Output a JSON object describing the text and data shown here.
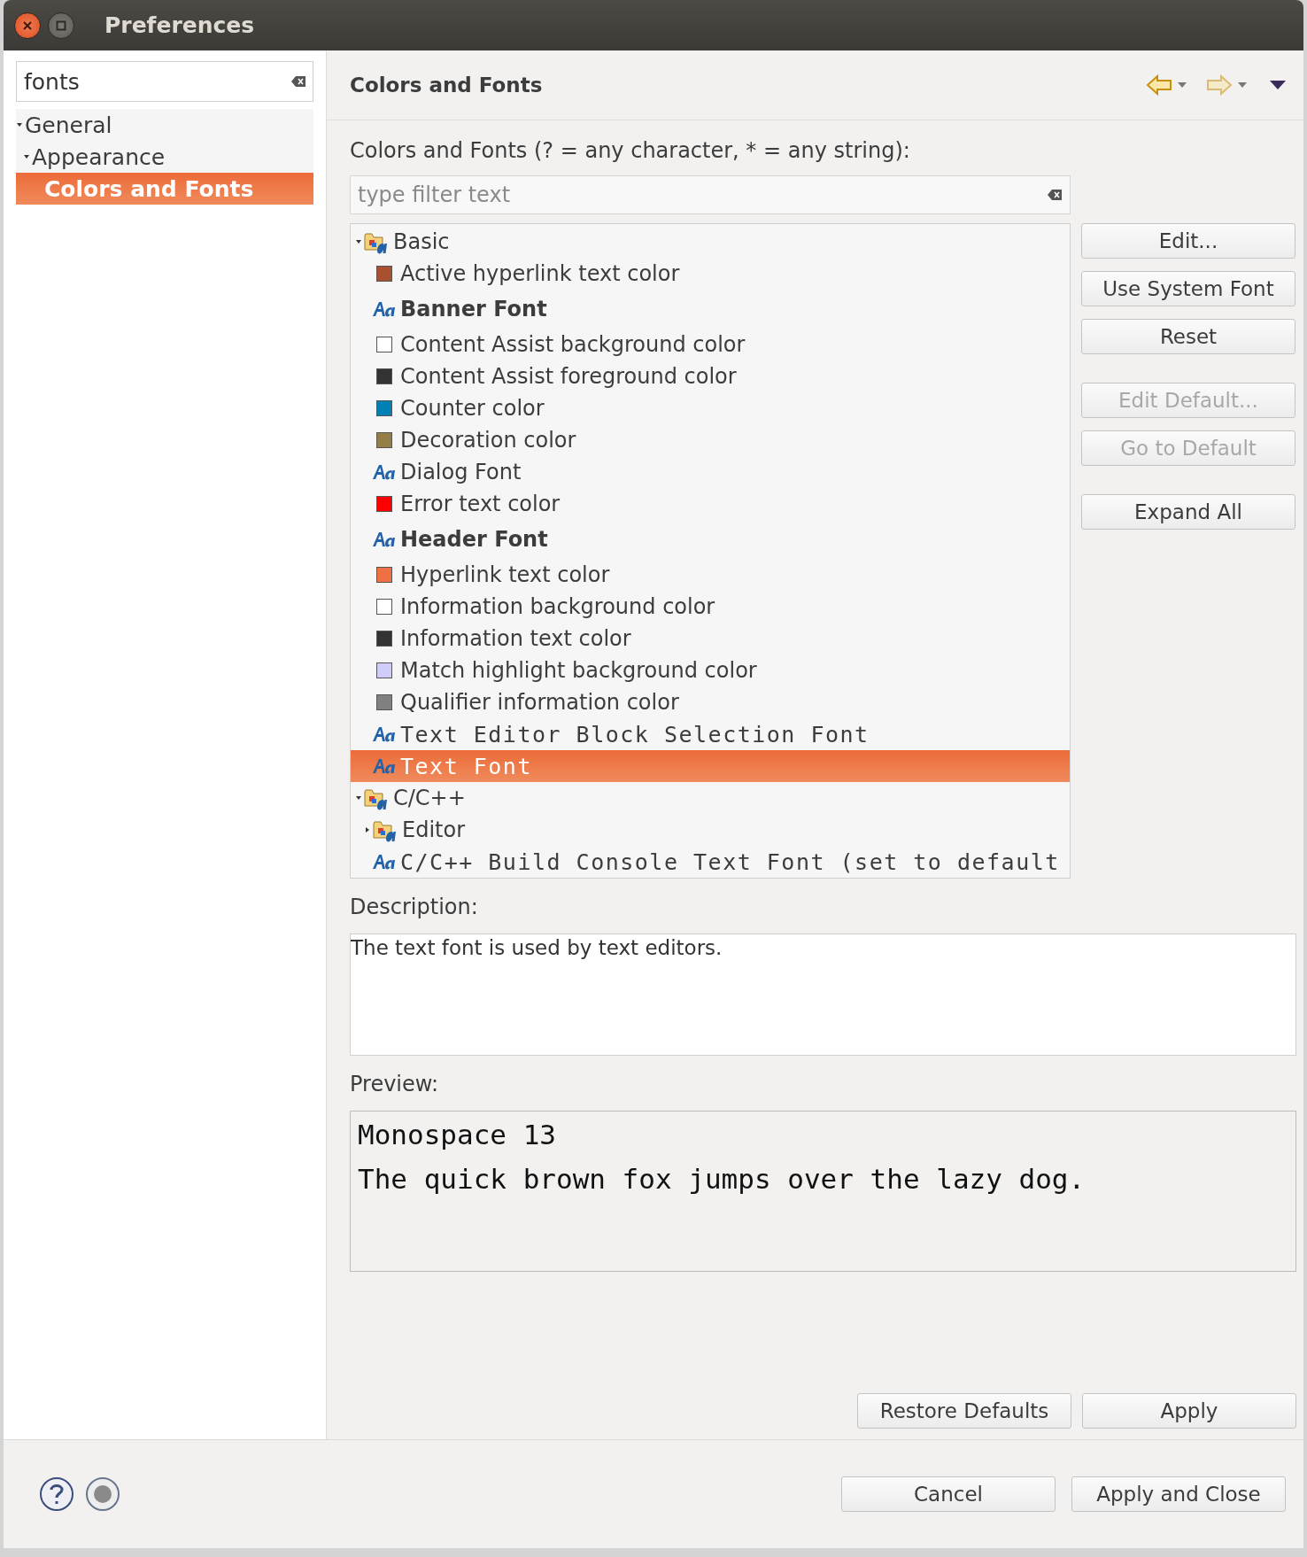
{
  "window": {
    "title": "Preferences"
  },
  "sidebar": {
    "search": {
      "value": "fonts"
    },
    "tree": [
      {
        "label": "General",
        "expanded": true,
        "selected": false,
        "children": [
          {
            "label": "Appearance",
            "expanded": true,
            "selected": false,
            "children": [
              {
                "label": "Colors and Fonts",
                "selected": true
              }
            ]
          }
        ]
      }
    ]
  },
  "page": {
    "title": "Colors and Fonts",
    "nav": {
      "back_disabled": false,
      "forward_disabled": true
    },
    "filter_label": "Colors and Fonts (? = any character, * = any string):",
    "filter": {
      "placeholder": "type filter text"
    },
    "tree": [
      {
        "kind": "category",
        "label": "Basic",
        "expanded": true,
        "selected": false,
        "children": [
          {
            "kind": "color",
            "label": "Active hyperlink text color",
            "color": "#a8502f",
            "selected": false
          },
          {
            "kind": "font",
            "bold": true,
            "monospace": false,
            "label": "Banner Font",
            "selected": false
          },
          {
            "kind": "color",
            "label": "Content Assist background color",
            "color": "#ffffff",
            "selected": false
          },
          {
            "kind": "color",
            "label": "Content Assist foreground color",
            "color": "#333333",
            "selected": false
          },
          {
            "kind": "color",
            "label": "Counter color",
            "color": "#0080b4",
            "selected": false
          },
          {
            "kind": "color",
            "label": "Decoration color",
            "color": "#957d47",
            "selected": false
          },
          {
            "kind": "font",
            "bold": false,
            "monospace": false,
            "label": "Dialog Font",
            "selected": false
          },
          {
            "kind": "color",
            "label": "Error text color",
            "color": "#ff0000",
            "selected": false
          },
          {
            "kind": "font",
            "bold": true,
            "monospace": false,
            "label": "Header Font",
            "selected": false
          },
          {
            "kind": "color",
            "label": "Hyperlink text color",
            "color": "#ef7043",
            "selected": false
          },
          {
            "kind": "color",
            "label": "Information background color",
            "color": "#ffffff",
            "selected": false
          },
          {
            "kind": "color",
            "label": "Information text color",
            "color": "#333333",
            "selected": false
          },
          {
            "kind": "color",
            "label": "Match highlight background color",
            "color": "#d0cdfa",
            "selected": false
          },
          {
            "kind": "color",
            "label": "Qualifier information color",
            "color": "#808080",
            "selected": false
          },
          {
            "kind": "font",
            "bold": false,
            "monospace": true,
            "label": "Text Editor Block Selection Font",
            "selected": false
          },
          {
            "kind": "font",
            "bold": false,
            "monospace": true,
            "label": "Text Font",
            "selected": true
          }
        ]
      },
      {
        "kind": "category",
        "label": "C/C++",
        "expanded": true,
        "selected": false,
        "children": [
          {
            "kind": "category",
            "label": "Editor",
            "expanded": false,
            "selected": false
          },
          {
            "kind": "font",
            "bold": false,
            "monospace": true,
            "label": "C/C++ Build Console Text Font (set to default",
            "selected": false
          }
        ]
      }
    ],
    "side_button_groups": [
      [
        {
          "label": "Edit...",
          "disabled": false
        },
        {
          "label": "Use System Font",
          "disabled": false
        },
        {
          "label": "Reset",
          "disabled": false
        }
      ],
      [
        {
          "label": "Edit Default...",
          "disabled": true
        },
        {
          "label": "Go to Default",
          "disabled": true
        }
      ],
      [
        {
          "label": "Expand All",
          "disabled": false
        }
      ]
    ],
    "description_label": "Description:",
    "description": "The text font is used by text editors.",
    "preview_label": "Preview:",
    "preview": [
      "Monospace 13",
      "The quick brown fox jumps over the lazy dog."
    ],
    "page_buttons": [
      "Restore Defaults",
      "Apply"
    ]
  },
  "dialog_buttons": [
    "Cancel",
    "Apply and Close"
  ]
}
